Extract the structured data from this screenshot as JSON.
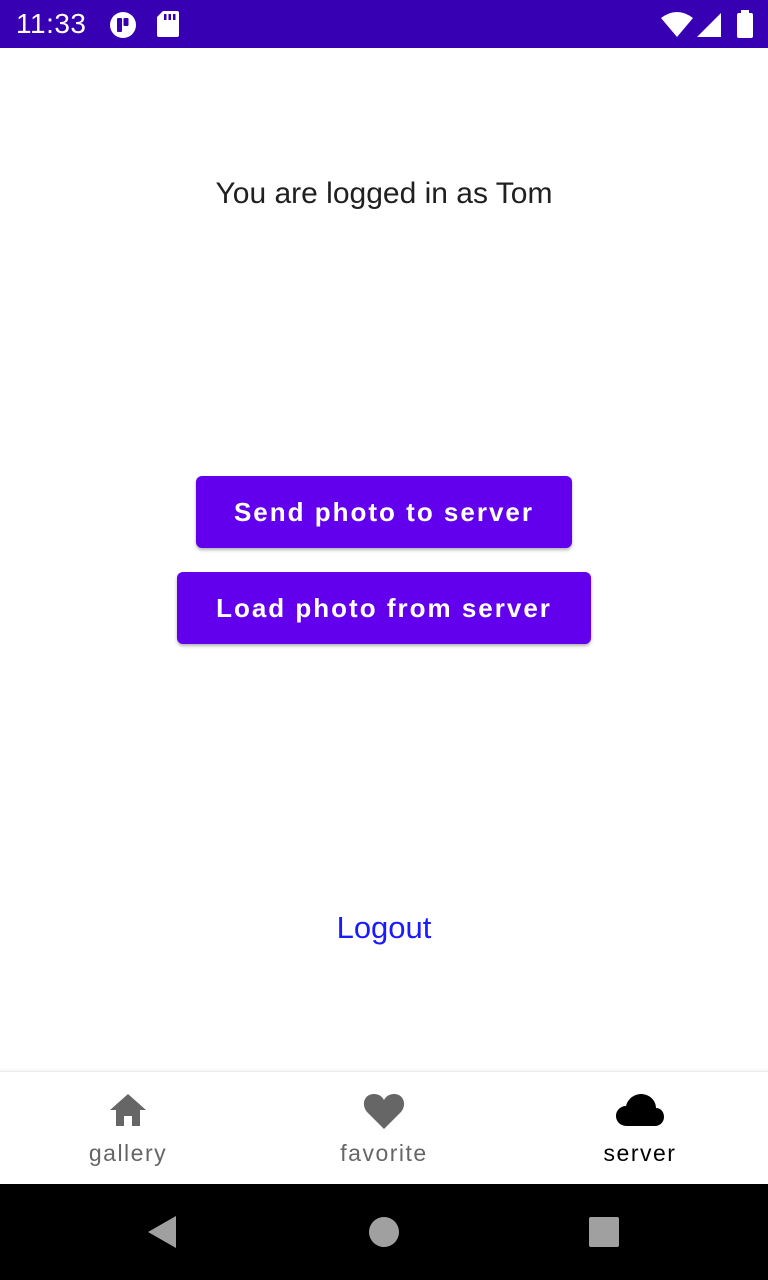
{
  "status_bar": {
    "time": "11:33",
    "background": "#3700b3",
    "icons": [
      "app-notification-icon",
      "sd-card-icon",
      "wifi-icon",
      "cellular-signal-icon",
      "battery-icon"
    ]
  },
  "main": {
    "logged_in_text": "You are logged in as Tom",
    "send_button_label": "Send photo to server",
    "load_button_label": "Load photo from server",
    "logout_label": "Logout",
    "accent_color": "#6200ee",
    "link_color": "#1a1aff"
  },
  "bottom_nav": {
    "items": [
      {
        "label": "gallery",
        "icon": "home-icon",
        "selected": false
      },
      {
        "label": "favorite",
        "icon": "heart-icon",
        "selected": false
      },
      {
        "label": "server",
        "icon": "cloud-icon",
        "selected": true
      }
    ],
    "selected_color": "#000000",
    "unselected_color": "#666666"
  },
  "system_nav": {
    "icons": [
      "back-icon",
      "home-circle-icon",
      "recents-icon"
    ]
  }
}
